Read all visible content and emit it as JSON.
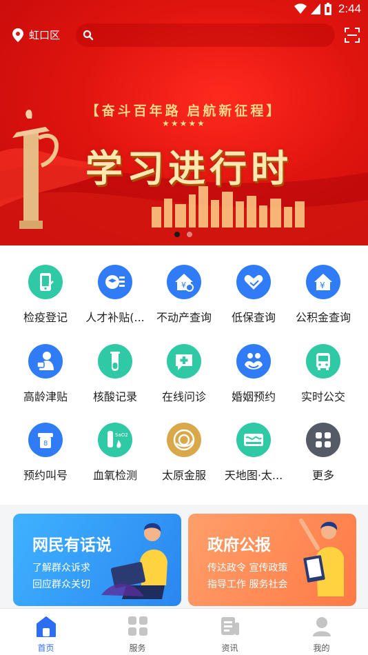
{
  "status_bar": {
    "time": "2:44"
  },
  "location": {
    "label": "虹口区"
  },
  "search": {
    "placeholder": ""
  },
  "banner": {
    "slogan": "【奋斗百年路 启航新征程】",
    "stars": "★★★★★",
    "headline": "学习进行时",
    "slide_count": 2,
    "active_slide": 1
  },
  "colors": {
    "banner_red": "#e0140f",
    "nav_active": "#2c6ef2",
    "nav_inactive": "#c4c4c4",
    "card_blue": "#2a86f0",
    "card_orange": "#ff7a45"
  },
  "services": [
    {
      "label": "检疫登记",
      "icon": "phone-register-icon",
      "color": "#2fc9a5"
    },
    {
      "label": "人才补贴(...",
      "icon": "graduation-cap-icon",
      "color": "#2f7cf6"
    },
    {
      "label": "不动产查询",
      "icon": "property-yuan-icon",
      "color": "#2f7cf6"
    },
    {
      "label": "低保查询",
      "icon": "heart-hand-icon",
      "color": "#2f7cf6"
    },
    {
      "label": "公积金查询",
      "icon": "house-yuan-icon",
      "color": "#2f7cf6"
    },
    {
      "label": "高龄津贴",
      "icon": "elderly-icon",
      "color": "#2f7cf6"
    },
    {
      "label": "核酸记录",
      "icon": "test-tube-icon",
      "color": "#2fc9a5"
    },
    {
      "label": "在线问诊",
      "icon": "medical-chat-icon",
      "color": "#2fc9a5"
    },
    {
      "label": "婚姻预约",
      "icon": "couple-icon",
      "color": "#2f7cf6"
    },
    {
      "label": "实时公交",
      "icon": "bus-icon",
      "color": "#2fc9a5"
    },
    {
      "label": "预约叫号",
      "icon": "queue-ticket-icon",
      "color": "#2f7cf6"
    },
    {
      "label": "血氧检测",
      "icon": "blood-oxygen-icon",
      "color": "#2fc9a5"
    },
    {
      "label": "太原金服",
      "icon": "finance-coin-icon",
      "color": "#d9a84a"
    },
    {
      "label": "天地图·太...",
      "icon": "map-world-icon",
      "color": "#2fc9a5"
    },
    {
      "label": "更多",
      "icon": "more-grid-icon",
      "color": "#555b66"
    }
  ],
  "cards": [
    {
      "title": "网民有话说",
      "lines": [
        "了解群众诉求",
        "回应群众关切"
      ]
    },
    {
      "title": "政府公报",
      "lines": [
        "传达政令  宣传政策",
        "指导工作  服务社会"
      ]
    }
  ],
  "nav": [
    {
      "label": "首页",
      "icon": "home-icon",
      "active": true
    },
    {
      "label": "服务",
      "icon": "services-grid-icon",
      "active": false
    },
    {
      "label": "资讯",
      "icon": "news-icon",
      "active": false
    },
    {
      "label": "我的",
      "icon": "profile-icon",
      "active": false
    }
  ]
}
